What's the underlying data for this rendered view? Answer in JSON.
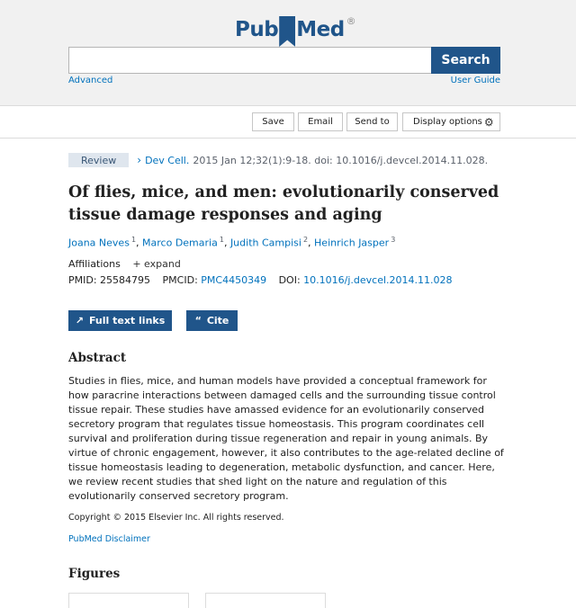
{
  "header": {
    "logo": {
      "part1": "Pub",
      "part2": "Med",
      "mark": "®"
    },
    "search": {
      "value": "",
      "placeholder": "",
      "button_label": "Search"
    },
    "advanced_label": "Advanced",
    "user_guide_label": "User Guide"
  },
  "actions": {
    "save_label": "Save",
    "email_label": "Email",
    "send_to_label": "Send to",
    "display_options_label": "Display options",
    "display_icon": "gear-icon"
  },
  "article": {
    "type_badge": "Review",
    "journal": "Dev Cell.",
    "citation": "2015 Jan 12;32(1):9-18. doi: 10.1016/j.devcel.2014.11.028.",
    "title": "Of flies, mice, and men: evolutionarily conserved tissue damage responses and aging",
    "authors": [
      {
        "name": "Joana Neves",
        "sup": "1"
      },
      {
        "name": "Marco Demaria",
        "sup": "1"
      },
      {
        "name": "Judith Campisi",
        "sup": "2"
      },
      {
        "name": "Heinrich Jasper",
        "sup": "3"
      }
    ],
    "affiliations_label": "Affiliations",
    "expand_label": "+ expand",
    "pmid_label": "PMID:",
    "pmid": "25584795",
    "pmcid_label": "PMCID:",
    "pmcid": "PMC4450349",
    "doi_label": "DOI:",
    "doi": "10.1016/j.devcel.2014.11.028"
  },
  "buttons": {
    "full_text_label": "Full text links",
    "cite_label": "Cite"
  },
  "abstract": {
    "heading": "Abstract",
    "text": "Studies in flies, mice, and human models have provided a conceptual framework for how paracrine interactions between damaged cells and the surrounding tissue control tissue repair. These studies have amassed evidence for an evolutionarily conserved secretory program that regulates tissue homeostasis. This program coordinates cell survival and proliferation during tissue regeneration and repair in young animals. By virtue of chronic engagement, however, it also contributes to the age-related decline of tissue homeostasis leading to degeneration, metabolic dysfunction, and cancer. Here, we review recent studies that shed light on the nature and regulation of this evolutionarily conserved secretory program.",
    "copyright": "Copyright © 2015 Elsevier Inc. All rights reserved.",
    "disclaimer": "PubMed Disclaimer"
  },
  "figures": {
    "heading": "Figures"
  }
}
